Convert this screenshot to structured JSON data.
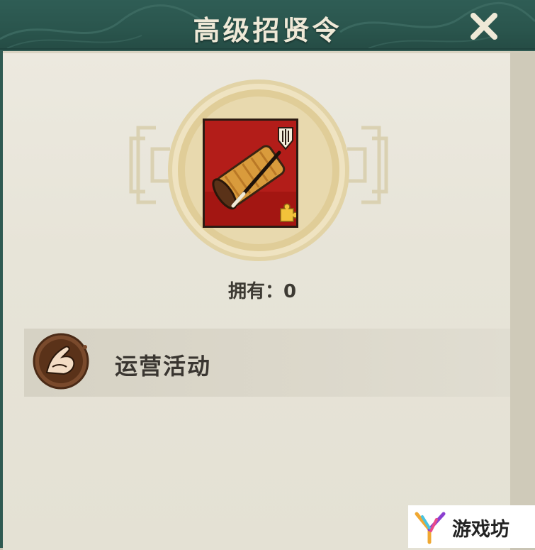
{
  "header": {
    "title": "高级招贤令"
  },
  "close_button": {
    "icon": "close-icon",
    "color": "#efe9d7"
  },
  "item": {
    "icon": "scroll-with-brush-icon",
    "badge_icon": "spear-rank-badge-icon",
    "corner_icon": "gold-puzzle-piece-icon",
    "background_color": "#b31d19"
  },
  "owned": {
    "text": "拥有：0"
  },
  "sources": [
    {
      "label": "运营活动",
      "icon": "cupped-hands-icon"
    }
  ],
  "watermark": {
    "text": "游戏坊"
  },
  "colors": {
    "header": "#2f5d55",
    "panel": "#e7e4d8",
    "emblem": "#e3d2a4"
  }
}
